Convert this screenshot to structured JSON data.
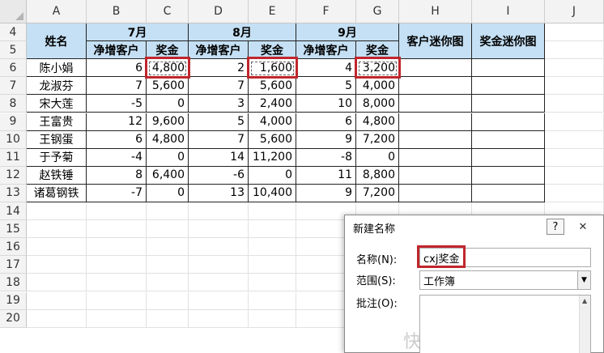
{
  "columns": [
    "A",
    "B",
    "C",
    "D",
    "E",
    "F",
    "G",
    "H",
    "I",
    "J"
  ],
  "rows": [
    "4",
    "5",
    "6",
    "7",
    "8",
    "9",
    "10",
    "11",
    "12",
    "13",
    "14",
    "15",
    "16",
    "17",
    "18",
    "19",
    "20"
  ],
  "headers": {
    "name": "姓名",
    "jul": "7月",
    "aug": "8月",
    "sep": "9月",
    "customers": "净增客户",
    "bonus": "奖金",
    "cust_spark": "客户迷你图",
    "bonus_spark": "奖金迷你图"
  },
  "data": [
    {
      "name": "陈小娟",
      "v": [
        "6",
        "4,800",
        "2",
        "1,600",
        "4",
        "3,200"
      ]
    },
    {
      "name": "龙淑芬",
      "v": [
        "7",
        "5,600",
        "7",
        "5,600",
        "5",
        "4,000"
      ]
    },
    {
      "name": "宋大莲",
      "v": [
        "-5",
        "0",
        "3",
        "2,400",
        "10",
        "8,000"
      ]
    },
    {
      "name": "王富贵",
      "v": [
        "12",
        "9,600",
        "5",
        "4,000",
        "6",
        "4,800"
      ]
    },
    {
      "name": "王钢蛋",
      "v": [
        "6",
        "4,800",
        "7",
        "5,600",
        "9",
        "7,200"
      ]
    },
    {
      "name": "于予菊",
      "v": [
        "-4",
        "0",
        "14",
        "11,200",
        "-8",
        "0"
      ]
    },
    {
      "name": "赵铁锤",
      "v": [
        "8",
        "6,400",
        "-6",
        "0",
        "11",
        "8,800"
      ]
    },
    {
      "name": "诸葛钢铁",
      "v": [
        "-7",
        "0",
        "13",
        "10,400",
        "9",
        "7,200"
      ]
    }
  ],
  "dialog": {
    "title": "新建名称",
    "help": "?",
    "close": "✕",
    "name_label": "名称(N):",
    "name_value": "cxj奖金",
    "scope_label": "范围(S):",
    "scope_value": "工作簿",
    "comment_label": "批注(O):"
  },
  "watermark": "快"
}
